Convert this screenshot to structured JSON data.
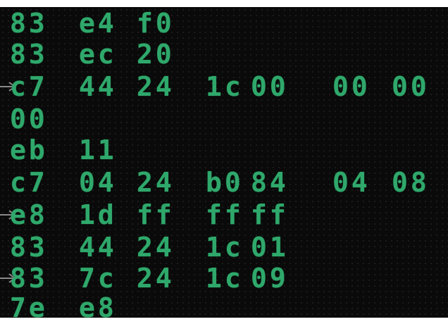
{
  "display": {
    "rows": [
      {
        "bytes": [
          "83",
          "e4",
          "f0"
        ],
        "pointer": false
      },
      {
        "bytes": [
          "83",
          "ec",
          "20"
        ],
        "pointer": false
      },
      {
        "bytes": [
          "c7",
          "44",
          "24",
          "1c",
          "00",
          "00",
          "00"
        ],
        "pointer": true
      },
      {
        "bytes": [
          "00"
        ],
        "pointer": false
      },
      {
        "bytes": [
          "eb",
          "11"
        ],
        "pointer": false
      },
      {
        "bytes": [
          "c7",
          "04",
          "24",
          "b0",
          "84",
          "04",
          "08"
        ],
        "pointer": false
      },
      {
        "bytes": [
          "e8",
          "1d",
          "ff",
          "ff",
          "ff"
        ],
        "pointer": true
      },
      {
        "bytes": [
          "83",
          "44",
          "24",
          "1c",
          "01"
        ],
        "pointer": false
      },
      {
        "bytes": [
          "83",
          "7c",
          "24",
          "1c",
          "09"
        ],
        "pointer": true
      },
      {
        "bytes": [
          "7e",
          "e8"
        ],
        "pointer": false
      }
    ]
  },
  "colors": {
    "digit": "#2fa86b",
    "screen": "#0a0a0a",
    "arrow": "#8a8a8a"
  },
  "icons": {
    "pointer": "arrow-right-icon"
  }
}
